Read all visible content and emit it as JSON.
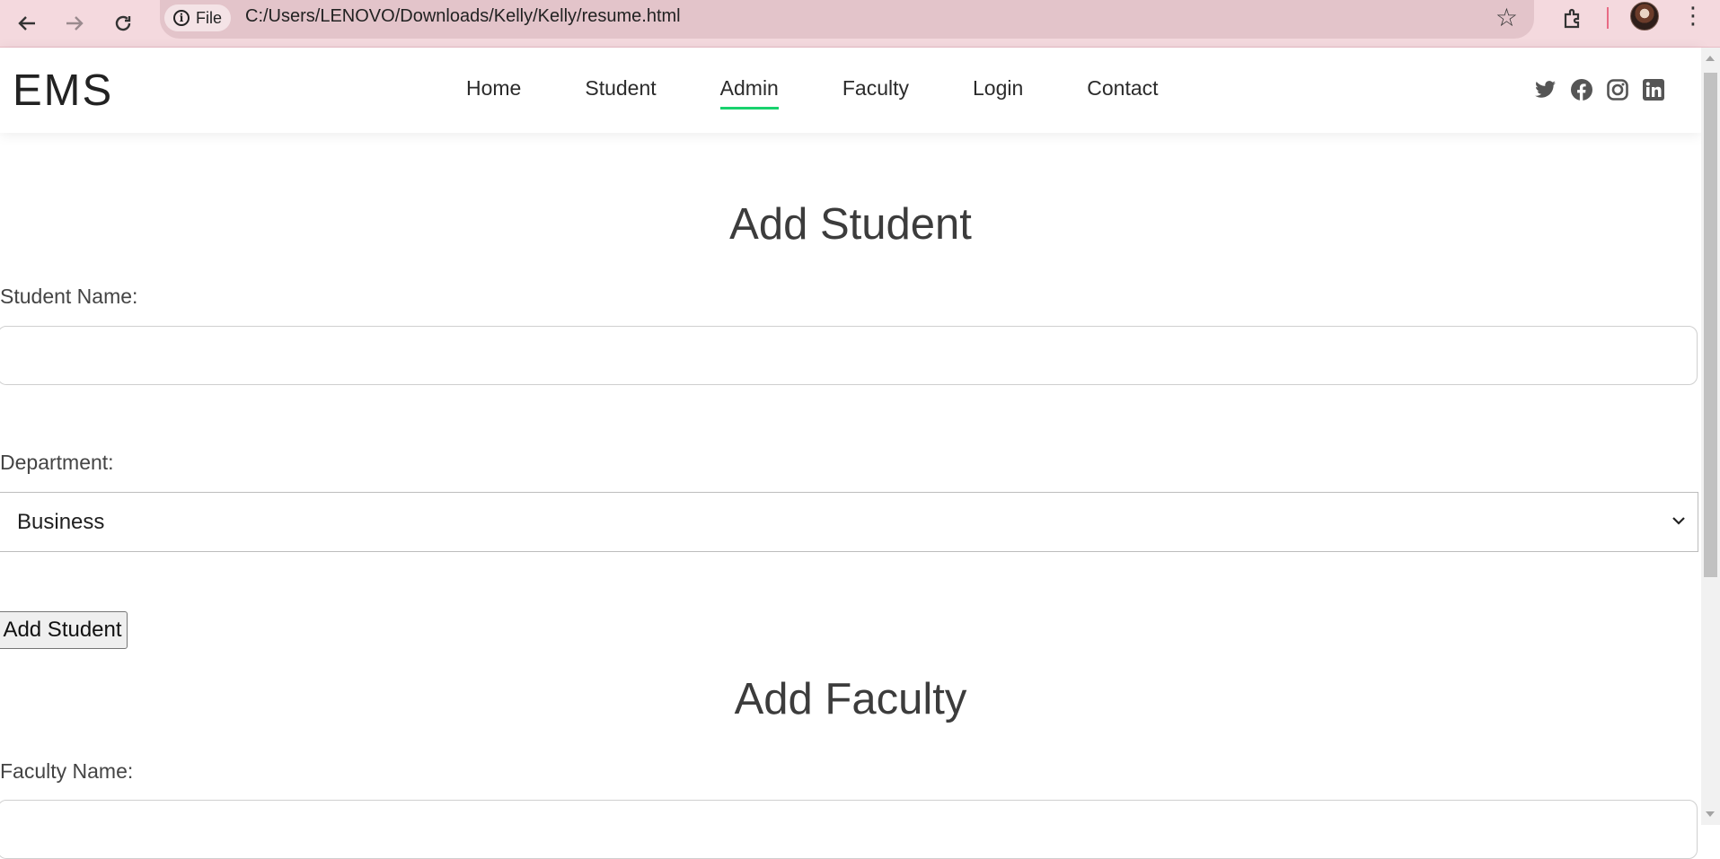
{
  "browser": {
    "file_chip_label": "File",
    "url": "C:/Users/LENOVO/Downloads/Kelly/Kelly/resume.html"
  },
  "header": {
    "logo": "EMS",
    "nav": [
      {
        "label": "Home",
        "active": false
      },
      {
        "label": "Student",
        "active": false
      },
      {
        "label": "Admin",
        "active": true
      },
      {
        "label": "Faculty",
        "active": false
      },
      {
        "label": "Login",
        "active": false
      },
      {
        "label": "Contact",
        "active": false
      }
    ],
    "social_icons": [
      "twitter-icon",
      "facebook-icon",
      "instagram-icon",
      "linkedin-icon"
    ]
  },
  "add_student": {
    "title": "Add Student",
    "name_label": "Student Name:",
    "name_value": "",
    "department_label": "Department:",
    "department_selected": "Business",
    "submit_label": "Add Student"
  },
  "add_faculty": {
    "title": "Add Faculty",
    "name_label": "Faculty Name:"
  },
  "colors": {
    "accent": "#18d26e",
    "chrome_bg": "#f4d9de"
  }
}
